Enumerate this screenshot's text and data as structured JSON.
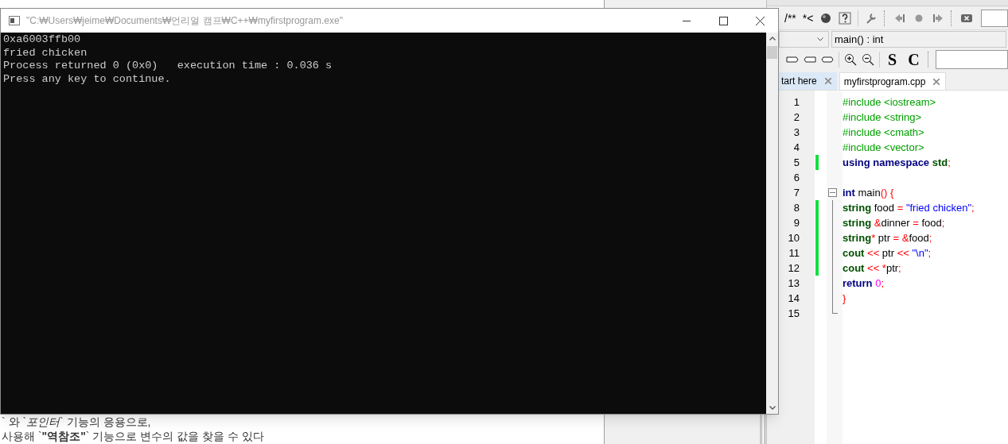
{
  "background_document": {
    "bottom_lines": [
      "` 와 `*포인터*` 기능의 응용으로,",
      "사용해 `**\"역참조\"**` 기능으로 변수의 값을 찾을 수 있다"
    ]
  },
  "ide": {
    "toolbar": {
      "comment_buttons": [
        "/**",
        "*<"
      ]
    },
    "scope": {
      "function": "main() : int"
    },
    "format_buttons": [
      "S",
      "C"
    ],
    "tabs": [
      {
        "label": "tart here",
        "selected": false
      },
      {
        "label": "myfirstprogram.cpp",
        "selected": true
      }
    ],
    "code_lines": [
      {
        "number": "1",
        "changed": false,
        "fold": false,
        "tokens": [
          {
            "kind": "preproc",
            "text": "#include <iostream>"
          }
        ]
      },
      {
        "number": "2",
        "changed": false,
        "fold": false,
        "tokens": [
          {
            "kind": "preproc",
            "text": "#include <string>"
          }
        ]
      },
      {
        "number": "3",
        "changed": false,
        "fold": false,
        "tokens": [
          {
            "kind": "preproc",
            "text": "#include <cmath>"
          }
        ]
      },
      {
        "number": "4",
        "changed": false,
        "fold": false,
        "tokens": [
          {
            "kind": "preproc",
            "text": "#include <vector>"
          }
        ]
      },
      {
        "number": "5",
        "changed": true,
        "fold": false,
        "tokens": [
          {
            "kind": "keyword",
            "text": "using namespace"
          },
          {
            "kind": "type",
            "text": " std"
          },
          {
            "kind": "op",
            "text": ";"
          }
        ]
      },
      {
        "number": "6",
        "changed": false,
        "fold": false
      },
      {
        "number": "7",
        "changed": false,
        "fold": true,
        "tokens": [
          {
            "kind": "keyword",
            "text": "int"
          },
          {
            "kind": "plain",
            "text": " main"
          },
          {
            "kind": "op",
            "text": "() {"
          }
        ]
      },
      {
        "number": "8",
        "changed": true,
        "fold": false,
        "tokens": [
          {
            "kind": "type",
            "text": "string"
          },
          {
            "kind": "plain",
            "text": " food "
          },
          {
            "kind": "op",
            "text": "= "
          },
          {
            "kind": "string",
            "text": "\"fried chicken\""
          },
          {
            "kind": "op",
            "text": ";"
          }
        ]
      },
      {
        "number": "9",
        "changed": true,
        "fold": false,
        "tokens": [
          {
            "kind": "type",
            "text": "string"
          },
          {
            "kind": "op",
            "text": " &"
          },
          {
            "kind": "plain",
            "text": "dinner "
          },
          {
            "kind": "op",
            "text": "="
          },
          {
            "kind": "plain",
            "text": " food"
          },
          {
            "kind": "op",
            "text": ";"
          }
        ]
      },
      {
        "number": "10",
        "changed": true,
        "fold": false,
        "tokens": [
          {
            "kind": "type",
            "text": "string"
          },
          {
            "kind": "op",
            "text": "*"
          },
          {
            "kind": "plain",
            "text": " ptr "
          },
          {
            "kind": "op",
            "text": "= &"
          },
          {
            "kind": "plain",
            "text": "food"
          },
          {
            "kind": "op",
            "text": ";"
          }
        ]
      },
      {
        "number": "11",
        "changed": true,
        "fold": false,
        "tokens": [
          {
            "kind": "type",
            "text": "cout"
          },
          {
            "kind": "op",
            "text": " <<"
          },
          {
            "kind": "plain",
            "text": " ptr "
          },
          {
            "kind": "op",
            "text": "<< "
          },
          {
            "kind": "string",
            "text": "\"\\n\""
          },
          {
            "kind": "op",
            "text": ";"
          }
        ]
      },
      {
        "number": "12",
        "changed": true,
        "fold": false,
        "tokens": [
          {
            "kind": "type",
            "text": "cout"
          },
          {
            "kind": "op",
            "text": " << *"
          },
          {
            "kind": "plain",
            "text": "ptr"
          },
          {
            "kind": "op",
            "text": ";"
          }
        ]
      },
      {
        "number": "13",
        "changed": false,
        "fold": false,
        "tokens": [
          {
            "kind": "keyword",
            "text": "return"
          },
          {
            "kind": "number",
            "text": " 0"
          },
          {
            "kind": "op",
            "text": ";"
          }
        ]
      },
      {
        "number": "14",
        "changed": false,
        "fold": false,
        "tokens": [
          {
            "kind": "op",
            "text": "}"
          }
        ]
      },
      {
        "number": "15",
        "changed": false,
        "fold": false
      }
    ]
  },
  "console": {
    "title": "\"C:₩Users₩jeime₩Documents₩언리얼 캠프₩C++₩myfirstprogram.exe\"",
    "output": [
      "0xa6003ffb00",
      "fried chicken",
      "Process returned 0 (0x0)   execution time : 0.036 s",
      "Press any key to continue."
    ]
  }
}
